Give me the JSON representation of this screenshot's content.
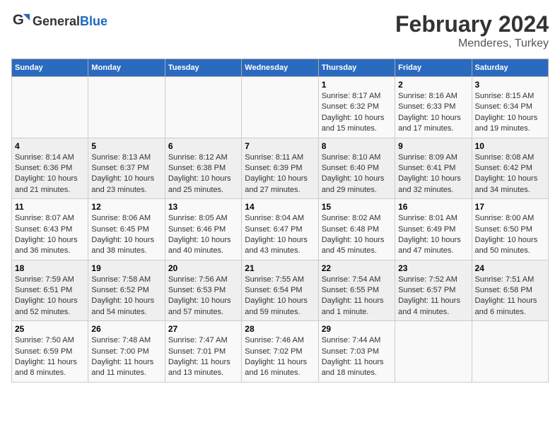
{
  "logo": {
    "text_general": "General",
    "text_blue": "Blue"
  },
  "title": "February 2024",
  "subtitle": "Menderes, Turkey",
  "days_of_week": [
    "Sunday",
    "Monday",
    "Tuesday",
    "Wednesday",
    "Thursday",
    "Friday",
    "Saturday"
  ],
  "weeks": [
    [
      {
        "day": "",
        "detail": ""
      },
      {
        "day": "",
        "detail": ""
      },
      {
        "day": "",
        "detail": ""
      },
      {
        "day": "",
        "detail": ""
      },
      {
        "day": "1",
        "detail": "Sunrise: 8:17 AM\nSunset: 6:32 PM\nDaylight: 10 hours and 15 minutes."
      },
      {
        "day": "2",
        "detail": "Sunrise: 8:16 AM\nSunset: 6:33 PM\nDaylight: 10 hours and 17 minutes."
      },
      {
        "day": "3",
        "detail": "Sunrise: 8:15 AM\nSunset: 6:34 PM\nDaylight: 10 hours and 19 minutes."
      }
    ],
    [
      {
        "day": "4",
        "detail": "Sunrise: 8:14 AM\nSunset: 6:36 PM\nDaylight: 10 hours and 21 minutes."
      },
      {
        "day": "5",
        "detail": "Sunrise: 8:13 AM\nSunset: 6:37 PM\nDaylight: 10 hours and 23 minutes."
      },
      {
        "day": "6",
        "detail": "Sunrise: 8:12 AM\nSunset: 6:38 PM\nDaylight: 10 hours and 25 minutes."
      },
      {
        "day": "7",
        "detail": "Sunrise: 8:11 AM\nSunset: 6:39 PM\nDaylight: 10 hours and 27 minutes."
      },
      {
        "day": "8",
        "detail": "Sunrise: 8:10 AM\nSunset: 6:40 PM\nDaylight: 10 hours and 29 minutes."
      },
      {
        "day": "9",
        "detail": "Sunrise: 8:09 AM\nSunset: 6:41 PM\nDaylight: 10 hours and 32 minutes."
      },
      {
        "day": "10",
        "detail": "Sunrise: 8:08 AM\nSunset: 6:42 PM\nDaylight: 10 hours and 34 minutes."
      }
    ],
    [
      {
        "day": "11",
        "detail": "Sunrise: 8:07 AM\nSunset: 6:43 PM\nDaylight: 10 hours and 36 minutes."
      },
      {
        "day": "12",
        "detail": "Sunrise: 8:06 AM\nSunset: 6:45 PM\nDaylight: 10 hours and 38 minutes."
      },
      {
        "day": "13",
        "detail": "Sunrise: 8:05 AM\nSunset: 6:46 PM\nDaylight: 10 hours and 40 minutes."
      },
      {
        "day": "14",
        "detail": "Sunrise: 8:04 AM\nSunset: 6:47 PM\nDaylight: 10 hours and 43 minutes."
      },
      {
        "day": "15",
        "detail": "Sunrise: 8:02 AM\nSunset: 6:48 PM\nDaylight: 10 hours and 45 minutes."
      },
      {
        "day": "16",
        "detail": "Sunrise: 8:01 AM\nSunset: 6:49 PM\nDaylight: 10 hours and 47 minutes."
      },
      {
        "day": "17",
        "detail": "Sunrise: 8:00 AM\nSunset: 6:50 PM\nDaylight: 10 hours and 50 minutes."
      }
    ],
    [
      {
        "day": "18",
        "detail": "Sunrise: 7:59 AM\nSunset: 6:51 PM\nDaylight: 10 hours and 52 minutes."
      },
      {
        "day": "19",
        "detail": "Sunrise: 7:58 AM\nSunset: 6:52 PM\nDaylight: 10 hours and 54 minutes."
      },
      {
        "day": "20",
        "detail": "Sunrise: 7:56 AM\nSunset: 6:53 PM\nDaylight: 10 hours and 57 minutes."
      },
      {
        "day": "21",
        "detail": "Sunrise: 7:55 AM\nSunset: 6:54 PM\nDaylight: 10 hours and 59 minutes."
      },
      {
        "day": "22",
        "detail": "Sunrise: 7:54 AM\nSunset: 6:55 PM\nDaylight: 11 hours and 1 minute."
      },
      {
        "day": "23",
        "detail": "Sunrise: 7:52 AM\nSunset: 6:57 PM\nDaylight: 11 hours and 4 minutes."
      },
      {
        "day": "24",
        "detail": "Sunrise: 7:51 AM\nSunset: 6:58 PM\nDaylight: 11 hours and 6 minutes."
      }
    ],
    [
      {
        "day": "25",
        "detail": "Sunrise: 7:50 AM\nSunset: 6:59 PM\nDaylight: 11 hours and 8 minutes."
      },
      {
        "day": "26",
        "detail": "Sunrise: 7:48 AM\nSunset: 7:00 PM\nDaylight: 11 hours and 11 minutes."
      },
      {
        "day": "27",
        "detail": "Sunrise: 7:47 AM\nSunset: 7:01 PM\nDaylight: 11 hours and 13 minutes."
      },
      {
        "day": "28",
        "detail": "Sunrise: 7:46 AM\nSunset: 7:02 PM\nDaylight: 11 hours and 16 minutes."
      },
      {
        "day": "29",
        "detail": "Sunrise: 7:44 AM\nSunset: 7:03 PM\nDaylight: 11 hours and 18 minutes."
      },
      {
        "day": "",
        "detail": ""
      },
      {
        "day": "",
        "detail": ""
      }
    ]
  ]
}
